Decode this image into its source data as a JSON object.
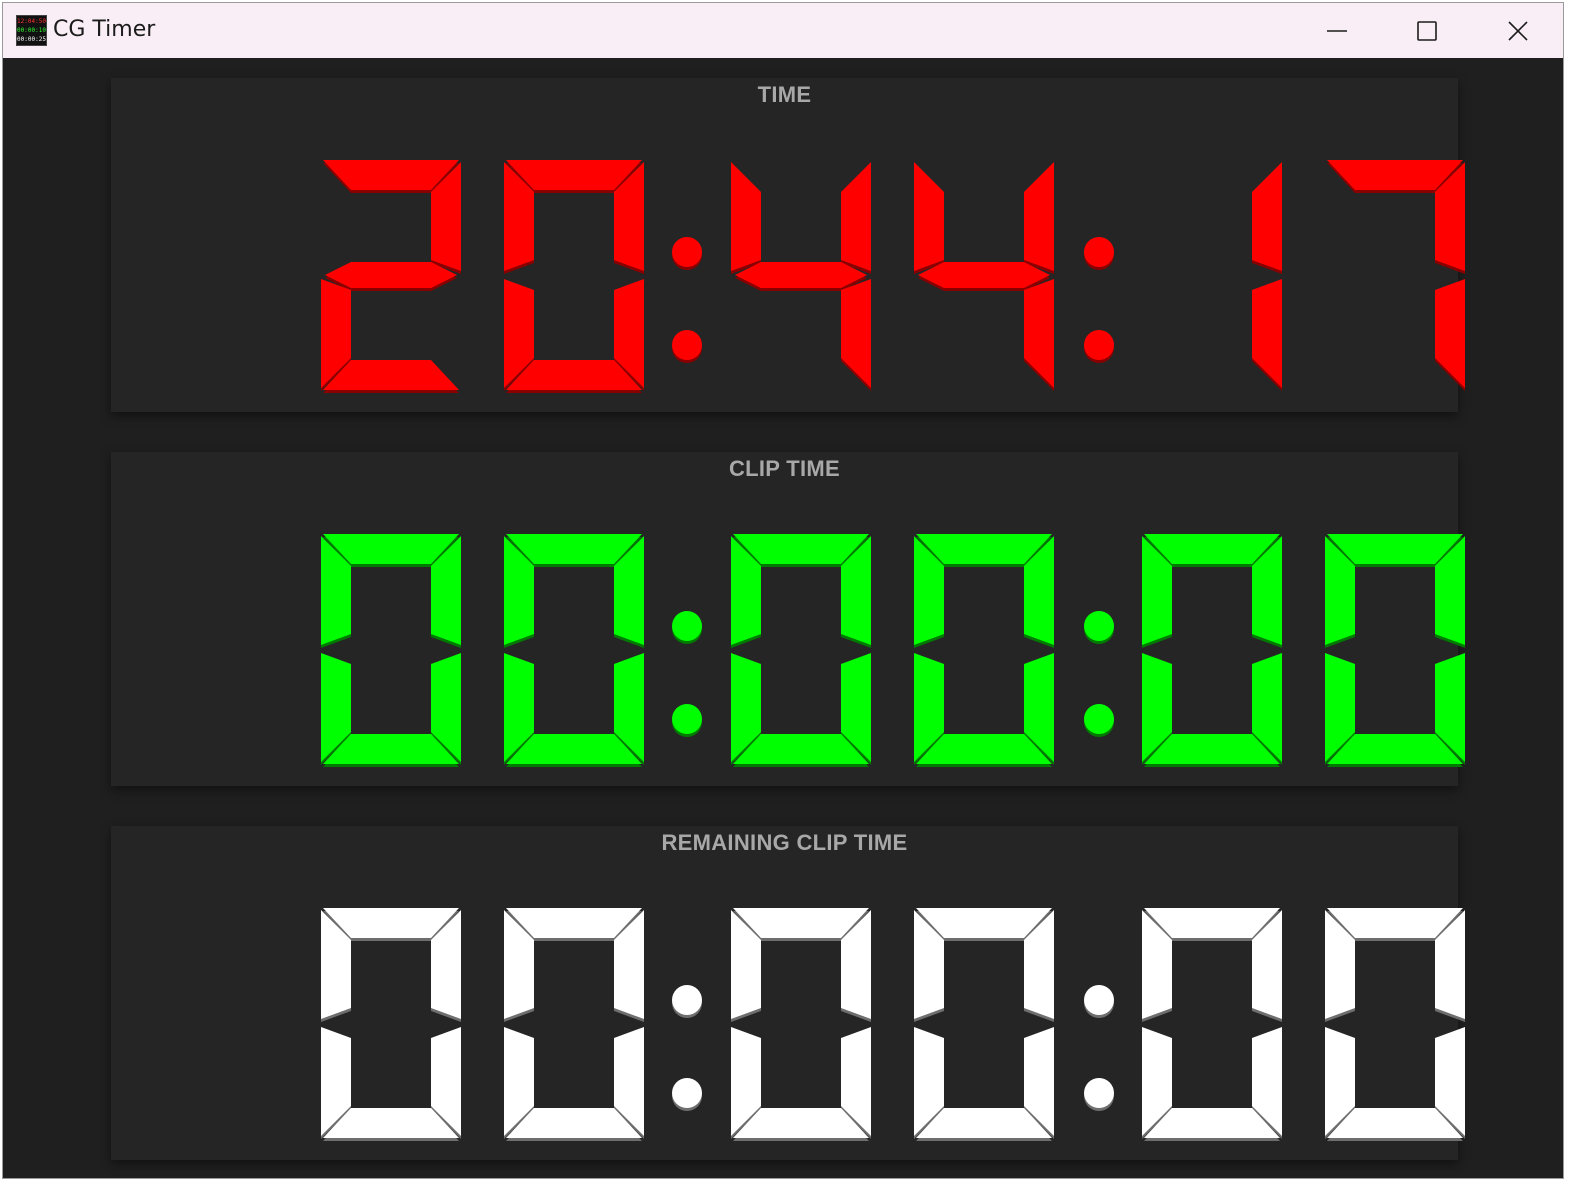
{
  "window": {
    "title": "CG Timer",
    "icon_lines": [
      "12:04:50",
      "00:00:10",
      "00:00:25"
    ],
    "controls": {
      "minimize": "minimize-icon",
      "maximize": "maximize-icon",
      "close": "close-icon"
    }
  },
  "panels": [
    {
      "id": "time",
      "label": "TIME",
      "value": "20:44:17",
      "color": "#ff0000",
      "shadow": "#8a0000"
    },
    {
      "id": "clip-time",
      "label": "CLIP TIME",
      "value": "00:00:00",
      "color": "#00ff00",
      "shadow": "#007a00"
    },
    {
      "id": "remaining-clip-time",
      "label": "REMAINING CLIP TIME",
      "value": "00:00:00",
      "color": "#ffffff",
      "shadow": "#6e6e6e"
    }
  ],
  "colors": {
    "background": "#1f1f1f",
    "panel": "#252525",
    "label": "#a8a8a8",
    "titlebar": "#f9eef5"
  }
}
